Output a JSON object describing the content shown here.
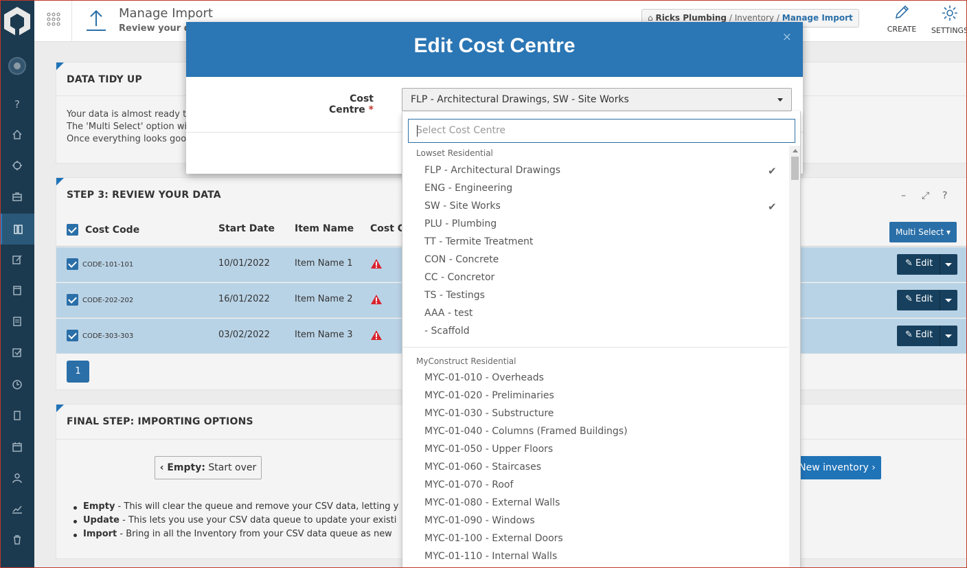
{
  "header": {
    "title": "Manage Import",
    "subtitle": "Review your data",
    "breadcrumb": {
      "home": "Ricks Plumbing",
      "middle": "Inventory",
      "current": "Manage Import",
      "sep": "/"
    },
    "actions": {
      "create": "CREATE",
      "settings": "SETTINGS"
    }
  },
  "tidy": {
    "title": "DATA TIDY UP",
    "lines": [
      "Your data is almost ready to go.",
      "The 'Multi Select' option will a",
      "Once everything looks good,"
    ]
  },
  "review": {
    "title": "STEP 3: REVIEW YOUR DATA",
    "columns": {
      "cost_code": "Cost Code",
      "start_date": "Start Date",
      "item_name": "Item Name",
      "cost_centre": "Cost Ce"
    },
    "multi_select": "Multi Select",
    "edit_label": "Edit",
    "rows": [
      {
        "code": "CODE-101-101",
        "date": "10/01/2022",
        "name": "Item Name 1"
      },
      {
        "code": "CODE-202-202",
        "date": "16/01/2022",
        "name": "Item Name 2"
      },
      {
        "code": "CODE-303-303",
        "date": "03/02/2022",
        "name": "Item Name 3"
      }
    ],
    "page": "1"
  },
  "final": {
    "title": "FINAL STEP: IMPORTING OPTIONS",
    "empty_bold": "Empty:",
    "empty_rest": "Start over",
    "new_inventory": "New inventory",
    "bullets": [
      {
        "bold": "Empty",
        "text": " - This will clear the queue and remove your CSV data, letting y"
      },
      {
        "bold": "Update",
        "text": " - This lets you use your CSV data queue to update your existi"
      },
      {
        "bold": "Import",
        "text": " - Bring in all the Inventory from your CSV data queue as new"
      }
    ]
  },
  "modal": {
    "title": "Edit Cost Centre",
    "close": "×",
    "field_label": "Cost Centre",
    "required": "*",
    "selected_value": "FLP - Architectural Drawings, SW - Site Works",
    "search_placeholder": "Select Cost Centre",
    "groups": [
      {
        "label": "Lowset Residential",
        "options": [
          {
            "label": "FLP - Architectural Drawings",
            "checked": true
          },
          {
            "label": "ENG - Engineering",
            "checked": false
          },
          {
            "label": "SW - Site Works",
            "checked": true
          },
          {
            "label": "PLU - Plumbing",
            "checked": false
          },
          {
            "label": "TT - Termite Treatment",
            "checked": false
          },
          {
            "label": "CON - Concrete",
            "checked": false
          },
          {
            "label": "CC - Concretor",
            "checked": false
          },
          {
            "label": "TS - Testings",
            "checked": false
          },
          {
            "label": "AAA - test",
            "checked": false
          },
          {
            "label": "- Scaffold",
            "checked": false
          }
        ]
      },
      {
        "label": "MyConstruct Residential",
        "options": [
          {
            "label": "MYC-01-010 - Overheads",
            "checked": false
          },
          {
            "label": "MYC-01-020 - Preliminaries",
            "checked": false
          },
          {
            "label": "MYC-01-030 - Substructure",
            "checked": false
          },
          {
            "label": "MYC-01-040 - Columns (Framed Buildings)",
            "checked": false
          },
          {
            "label": "MYC-01-050 - Upper Floors",
            "checked": false
          },
          {
            "label": "MYC-01-060 - Staircases",
            "checked": false
          },
          {
            "label": "MYC-01-070 - Roof",
            "checked": false
          },
          {
            "label": "MYC-01-080 - External Walls",
            "checked": false
          },
          {
            "label": "MYC-01-090 - Windows",
            "checked": false
          },
          {
            "label": "MYC-01-100 - External Doors",
            "checked": false
          },
          {
            "label": "MYC-01-110 - Internal Walls",
            "checked": false
          }
        ]
      }
    ]
  },
  "colors": {
    "primary": "#2b76b4",
    "sidebar": "#1c3a4f",
    "row_selected": "#b9d3e6",
    "warning": "#d9232d"
  }
}
